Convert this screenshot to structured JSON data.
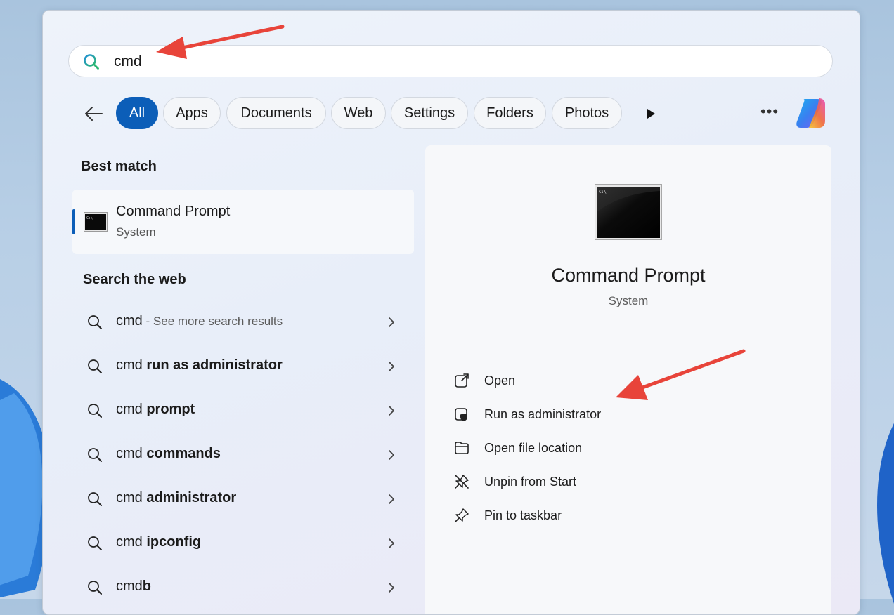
{
  "search": {
    "query": "cmd"
  },
  "filters": {
    "chips": [
      "All",
      "Apps",
      "Documents",
      "Web",
      "Settings",
      "Folders",
      "Photos"
    ],
    "active": "All"
  },
  "best_match": {
    "heading": "Best match",
    "name": "Command Prompt",
    "category": "System",
    "icon": "command-prompt-icon"
  },
  "web_search": {
    "heading": "Search the web",
    "items": [
      {
        "prefix": "cmd",
        "bold": "",
        "hint": " - See more search results"
      },
      {
        "prefix": "cmd ",
        "bold": "run as administrator",
        "hint": ""
      },
      {
        "prefix": "cmd ",
        "bold": "prompt",
        "hint": ""
      },
      {
        "prefix": "cmd ",
        "bold": "commands",
        "hint": ""
      },
      {
        "prefix": "cmd ",
        "bold": "administrator",
        "hint": ""
      },
      {
        "prefix": "cmd ",
        "bold": "ipconfig",
        "hint": ""
      },
      {
        "prefix": "cmd",
        "bold": "b",
        "hint": ""
      }
    ]
  },
  "detail": {
    "title": "Command Prompt",
    "subtitle": "System",
    "actions": [
      {
        "label": "Open",
        "icon": "open-external-icon"
      },
      {
        "label": "Run as administrator",
        "icon": "shield-icon"
      },
      {
        "label": "Open file location",
        "icon": "folder-icon"
      },
      {
        "label": "Unpin from Start",
        "icon": "unpin-icon"
      },
      {
        "label": "Pin to taskbar",
        "icon": "pin-icon"
      }
    ]
  },
  "colors": {
    "accent": "#0c5eb8",
    "annotation": "#e8443a"
  }
}
